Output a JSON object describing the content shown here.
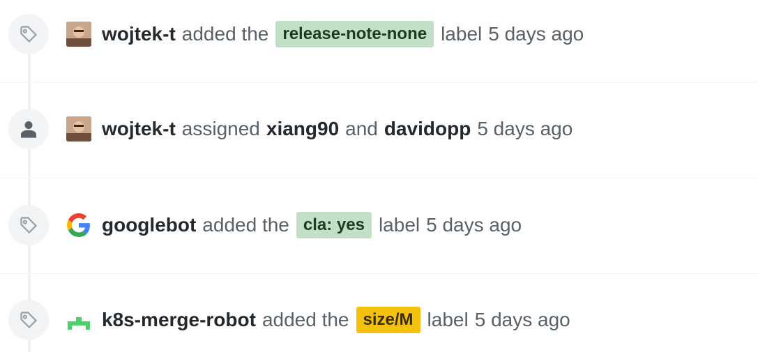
{
  "events": [
    {
      "type": "labeled",
      "icon": "tag-icon",
      "author": "wojtek-t",
      "avatar": "avatar-photo",
      "verb": "added the",
      "label": {
        "text": "release-note-none",
        "color": "#c2e0c6"
      },
      "suffix": "label",
      "time": "5 days ago"
    },
    {
      "type": "assigned",
      "icon": "person-icon",
      "author": "wojtek-t",
      "avatar": "avatar-photo",
      "verb": "assigned",
      "assignee1": "xiang90",
      "conj": "and",
      "assignee2": "davidopp",
      "time": "5 days ago"
    },
    {
      "type": "labeled",
      "icon": "tag-icon",
      "author": "googlebot",
      "avatar": "google-logo",
      "verb": "added the",
      "label": {
        "text": "cla: yes",
        "color": "#c2e0c6"
      },
      "suffix": "label",
      "time": "5 days ago"
    },
    {
      "type": "labeled",
      "icon": "tag-icon",
      "author": "k8s-merge-robot",
      "avatar": "robot-icon",
      "verb": "added the",
      "label": {
        "text": "size/M",
        "color": "#f4c20d"
      },
      "suffix": "label",
      "time": "5 days ago"
    }
  ]
}
